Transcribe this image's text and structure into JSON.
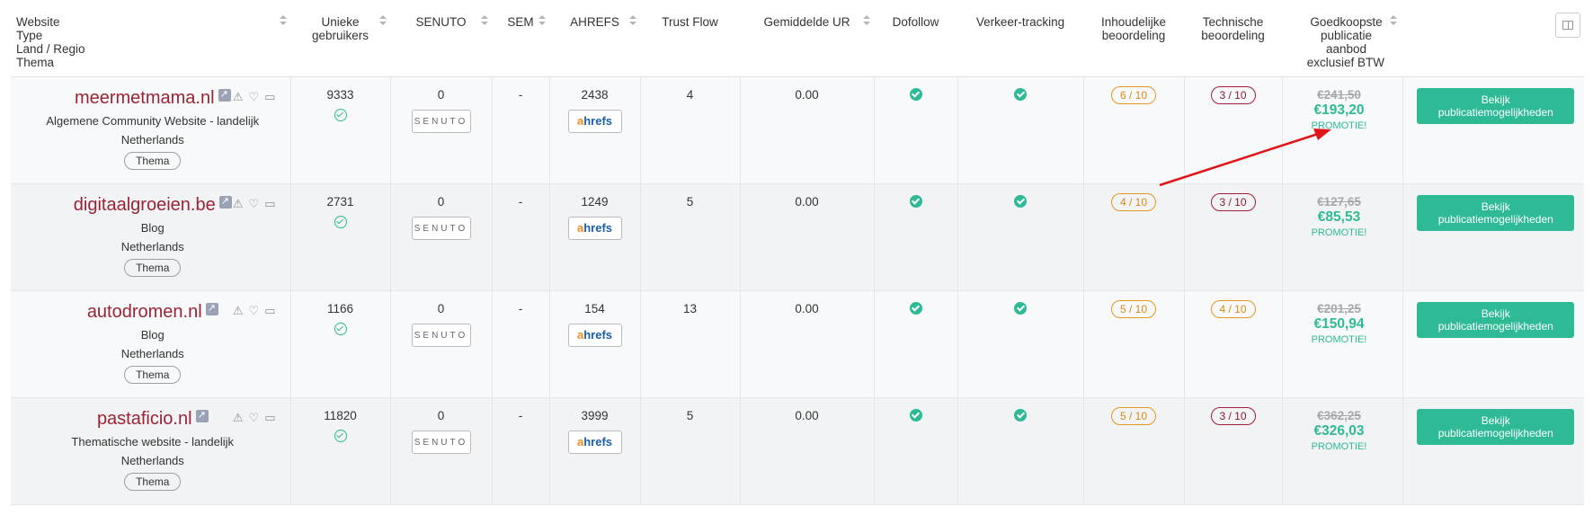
{
  "headers": {
    "website": [
      "Website",
      "Type",
      "Land / Regio",
      "Thema"
    ],
    "unique_users": "Unieke gebruikers",
    "senuto": "SENUTO",
    "sem": "SEM",
    "ahrefs": "AHREFS",
    "trust_flow": "Trust Flow",
    "avg_ur": "Gemiddelde UR",
    "dofollow": "Dofollow",
    "traffic_tracking": "Verkeer-tracking",
    "content_rating": "Inhoudelijke beoordeling",
    "technical_rating": "Technische beoordeling",
    "cheapest_offer": "Goedkoopste publicatie aanbod",
    "vat_note": "exclusief BTW"
  },
  "senuto_logo": "SENUTO",
  "ahrefs_logo": {
    "a": "a",
    "rest": "hrefs"
  },
  "thema_label": "Thema",
  "action_label": "Bekijk publicatiemogelijkheden",
  "promo_label": "PROMOTIE!",
  "rows": [
    {
      "name": "meermetmama.nl",
      "type": "Algemene Community Website - landelijk",
      "country": "Netherlands",
      "unique_users": "9333",
      "senuto": "0",
      "sem": "-",
      "ahrefs": "2438",
      "trust_flow": "4",
      "avg_ur": "0.00",
      "content_rating": "6 / 10",
      "technical_rating": "3 / 10",
      "old_price": "€241,50",
      "new_price": "€193,20"
    },
    {
      "name": "digitaalgroeien.be",
      "type": "Blog",
      "country": "Netherlands",
      "unique_users": "2731",
      "senuto": "0",
      "sem": "-",
      "ahrefs": "1249",
      "trust_flow": "5",
      "avg_ur": "0.00",
      "content_rating": "4 / 10",
      "technical_rating": "3 / 10",
      "old_price": "€127,65",
      "new_price": "€85,53"
    },
    {
      "name": "autodromen.nl",
      "type": "Blog",
      "country": "Netherlands",
      "unique_users": "1166",
      "senuto": "0",
      "sem": "-",
      "ahrefs": "154",
      "trust_flow": "13",
      "avg_ur": "0.00",
      "content_rating": "5 / 10",
      "technical_rating": "4 / 10",
      "old_price": "€201,25",
      "new_price": "€150,94"
    },
    {
      "name": "pastaficio.nl",
      "type": "Thematische website - landelijk",
      "country": "Netherlands",
      "unique_users": "11820",
      "senuto": "0",
      "sem": "-",
      "ahrefs": "3999",
      "trust_flow": "5",
      "avg_ur": "0.00",
      "content_rating": "5 / 10",
      "technical_rating": "3 / 10",
      "old_price": "€362,25",
      "new_price": "€326,03"
    }
  ],
  "colors": {
    "accent": "#2fba96",
    "site_link": "#9b2335",
    "score_orange": "#e3991f",
    "score_red": "#a51d3a",
    "annotation_arrow": "#e0161b"
  }
}
